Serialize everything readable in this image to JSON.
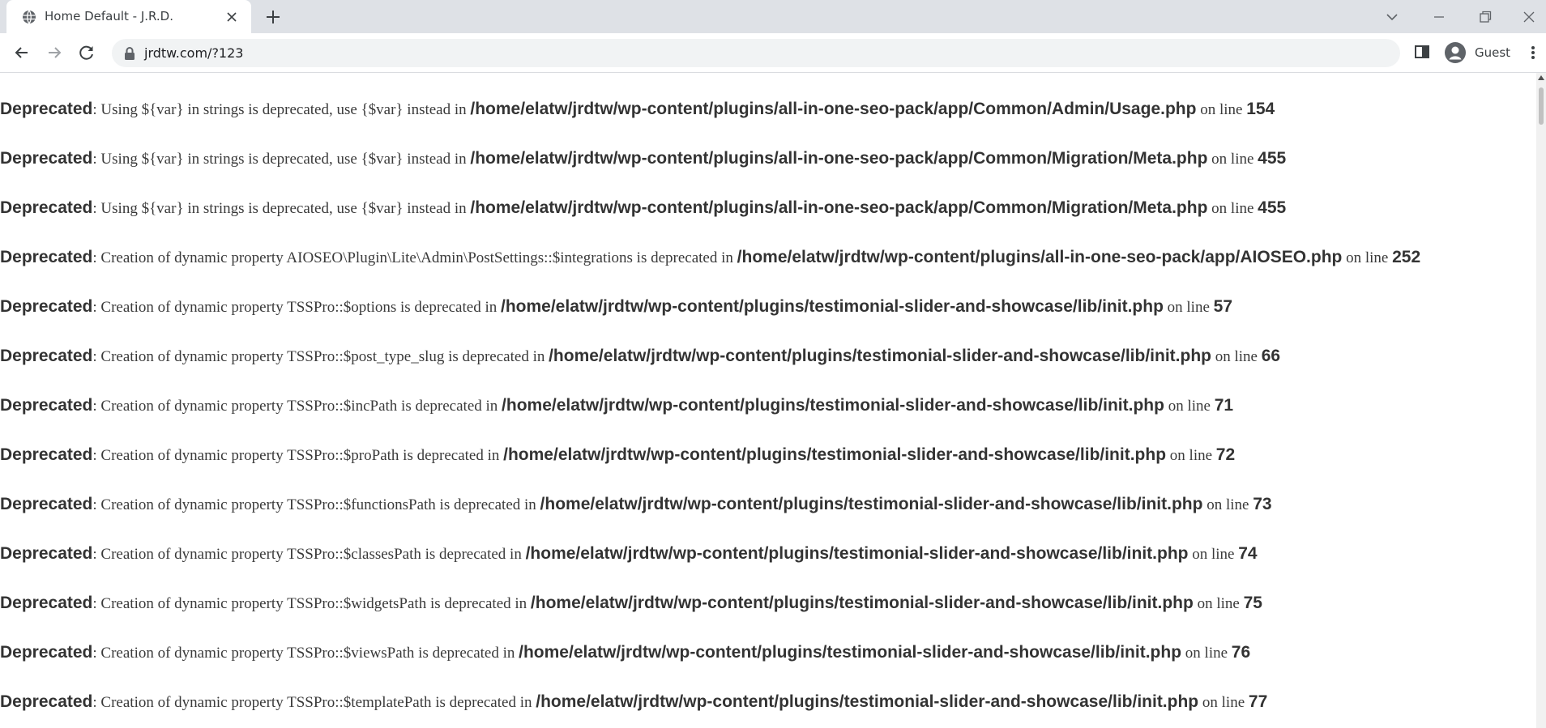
{
  "browser": {
    "tab_title": "Home Default - J.R.D.",
    "url": "jrdtw.com/?123",
    "profile_label": "Guest"
  },
  "messages": [
    {
      "label": "Deprecated",
      "sep": ": ",
      "text": "Using ${var} in strings is deprecated, use {$var} instead in ",
      "path": "/home/elatw/jrdtw/wp-content/plugins/all-in-one-seo-pack/app/Common/Admin/Usage.php",
      "online": " on line ",
      "line": "154"
    },
    {
      "label": "Deprecated",
      "sep": ": ",
      "text": "Using ${var} in strings is deprecated, use {$var} instead in ",
      "path": "/home/elatw/jrdtw/wp-content/plugins/all-in-one-seo-pack/app/Common/Migration/Meta.php",
      "online": " on line ",
      "line": "455"
    },
    {
      "label": "Deprecated",
      "sep": ": ",
      "text": "Using ${var} in strings is deprecated, use {$var} instead in ",
      "path": "/home/elatw/jrdtw/wp-content/plugins/all-in-one-seo-pack/app/Common/Migration/Meta.php",
      "online": " on line ",
      "line": "455"
    },
    {
      "label": "Deprecated",
      "sep": ": ",
      "text": "Creation of dynamic property AIOSEO\\Plugin\\Lite\\Admin\\PostSettings::$integrations is deprecated in ",
      "path": "/home/elatw/jrdtw/wp-content/plugins/all-in-one-seo-pack/app/AIOSEO.php",
      "online": " on line ",
      "line": "252"
    },
    {
      "label": "Deprecated",
      "sep": ": ",
      "text": "Creation of dynamic property TSSPro::$options is deprecated in ",
      "path": "/home/elatw/jrdtw/wp-content/plugins/testimonial-slider-and-showcase/lib/init.php",
      "online": " on line ",
      "line": "57"
    },
    {
      "label": "Deprecated",
      "sep": ": ",
      "text": "Creation of dynamic property TSSPro::$post_type_slug is deprecated in ",
      "path": "/home/elatw/jrdtw/wp-content/plugins/testimonial-slider-and-showcase/lib/init.php",
      "online": " on line ",
      "line": "66"
    },
    {
      "label": "Deprecated",
      "sep": ": ",
      "text": "Creation of dynamic property TSSPro::$incPath is deprecated in ",
      "path": "/home/elatw/jrdtw/wp-content/plugins/testimonial-slider-and-showcase/lib/init.php",
      "online": " on line ",
      "line": "71"
    },
    {
      "label": "Deprecated",
      "sep": ": ",
      "text": "Creation of dynamic property TSSPro::$proPath is deprecated in ",
      "path": "/home/elatw/jrdtw/wp-content/plugins/testimonial-slider-and-showcase/lib/init.php",
      "online": " on line ",
      "line": "72"
    },
    {
      "label": "Deprecated",
      "sep": ": ",
      "text": "Creation of dynamic property TSSPro::$functionsPath is deprecated in ",
      "path": "/home/elatw/jrdtw/wp-content/plugins/testimonial-slider-and-showcase/lib/init.php",
      "online": " on line ",
      "line": "73"
    },
    {
      "label": "Deprecated",
      "sep": ": ",
      "text": "Creation of dynamic property TSSPro::$classesPath is deprecated in ",
      "path": "/home/elatw/jrdtw/wp-content/plugins/testimonial-slider-and-showcase/lib/init.php",
      "online": " on line ",
      "line": "74"
    },
    {
      "label": "Deprecated",
      "sep": ": ",
      "text": "Creation of dynamic property TSSPro::$widgetsPath is deprecated in ",
      "path": "/home/elatw/jrdtw/wp-content/plugins/testimonial-slider-and-showcase/lib/init.php",
      "online": " on line ",
      "line": "75"
    },
    {
      "label": "Deprecated",
      "sep": ": ",
      "text": "Creation of dynamic property TSSPro::$viewsPath is deprecated in ",
      "path": "/home/elatw/jrdtw/wp-content/plugins/testimonial-slider-and-showcase/lib/init.php",
      "online": " on line ",
      "line": "76"
    },
    {
      "label": "Deprecated",
      "sep": ": ",
      "text": "Creation of dynamic property TSSPro::$templatePath is deprecated in ",
      "path": "/home/elatw/jrdtw/wp-content/plugins/testimonial-slider-and-showcase/lib/init.php",
      "online": " on line ",
      "line": "77"
    }
  ]
}
